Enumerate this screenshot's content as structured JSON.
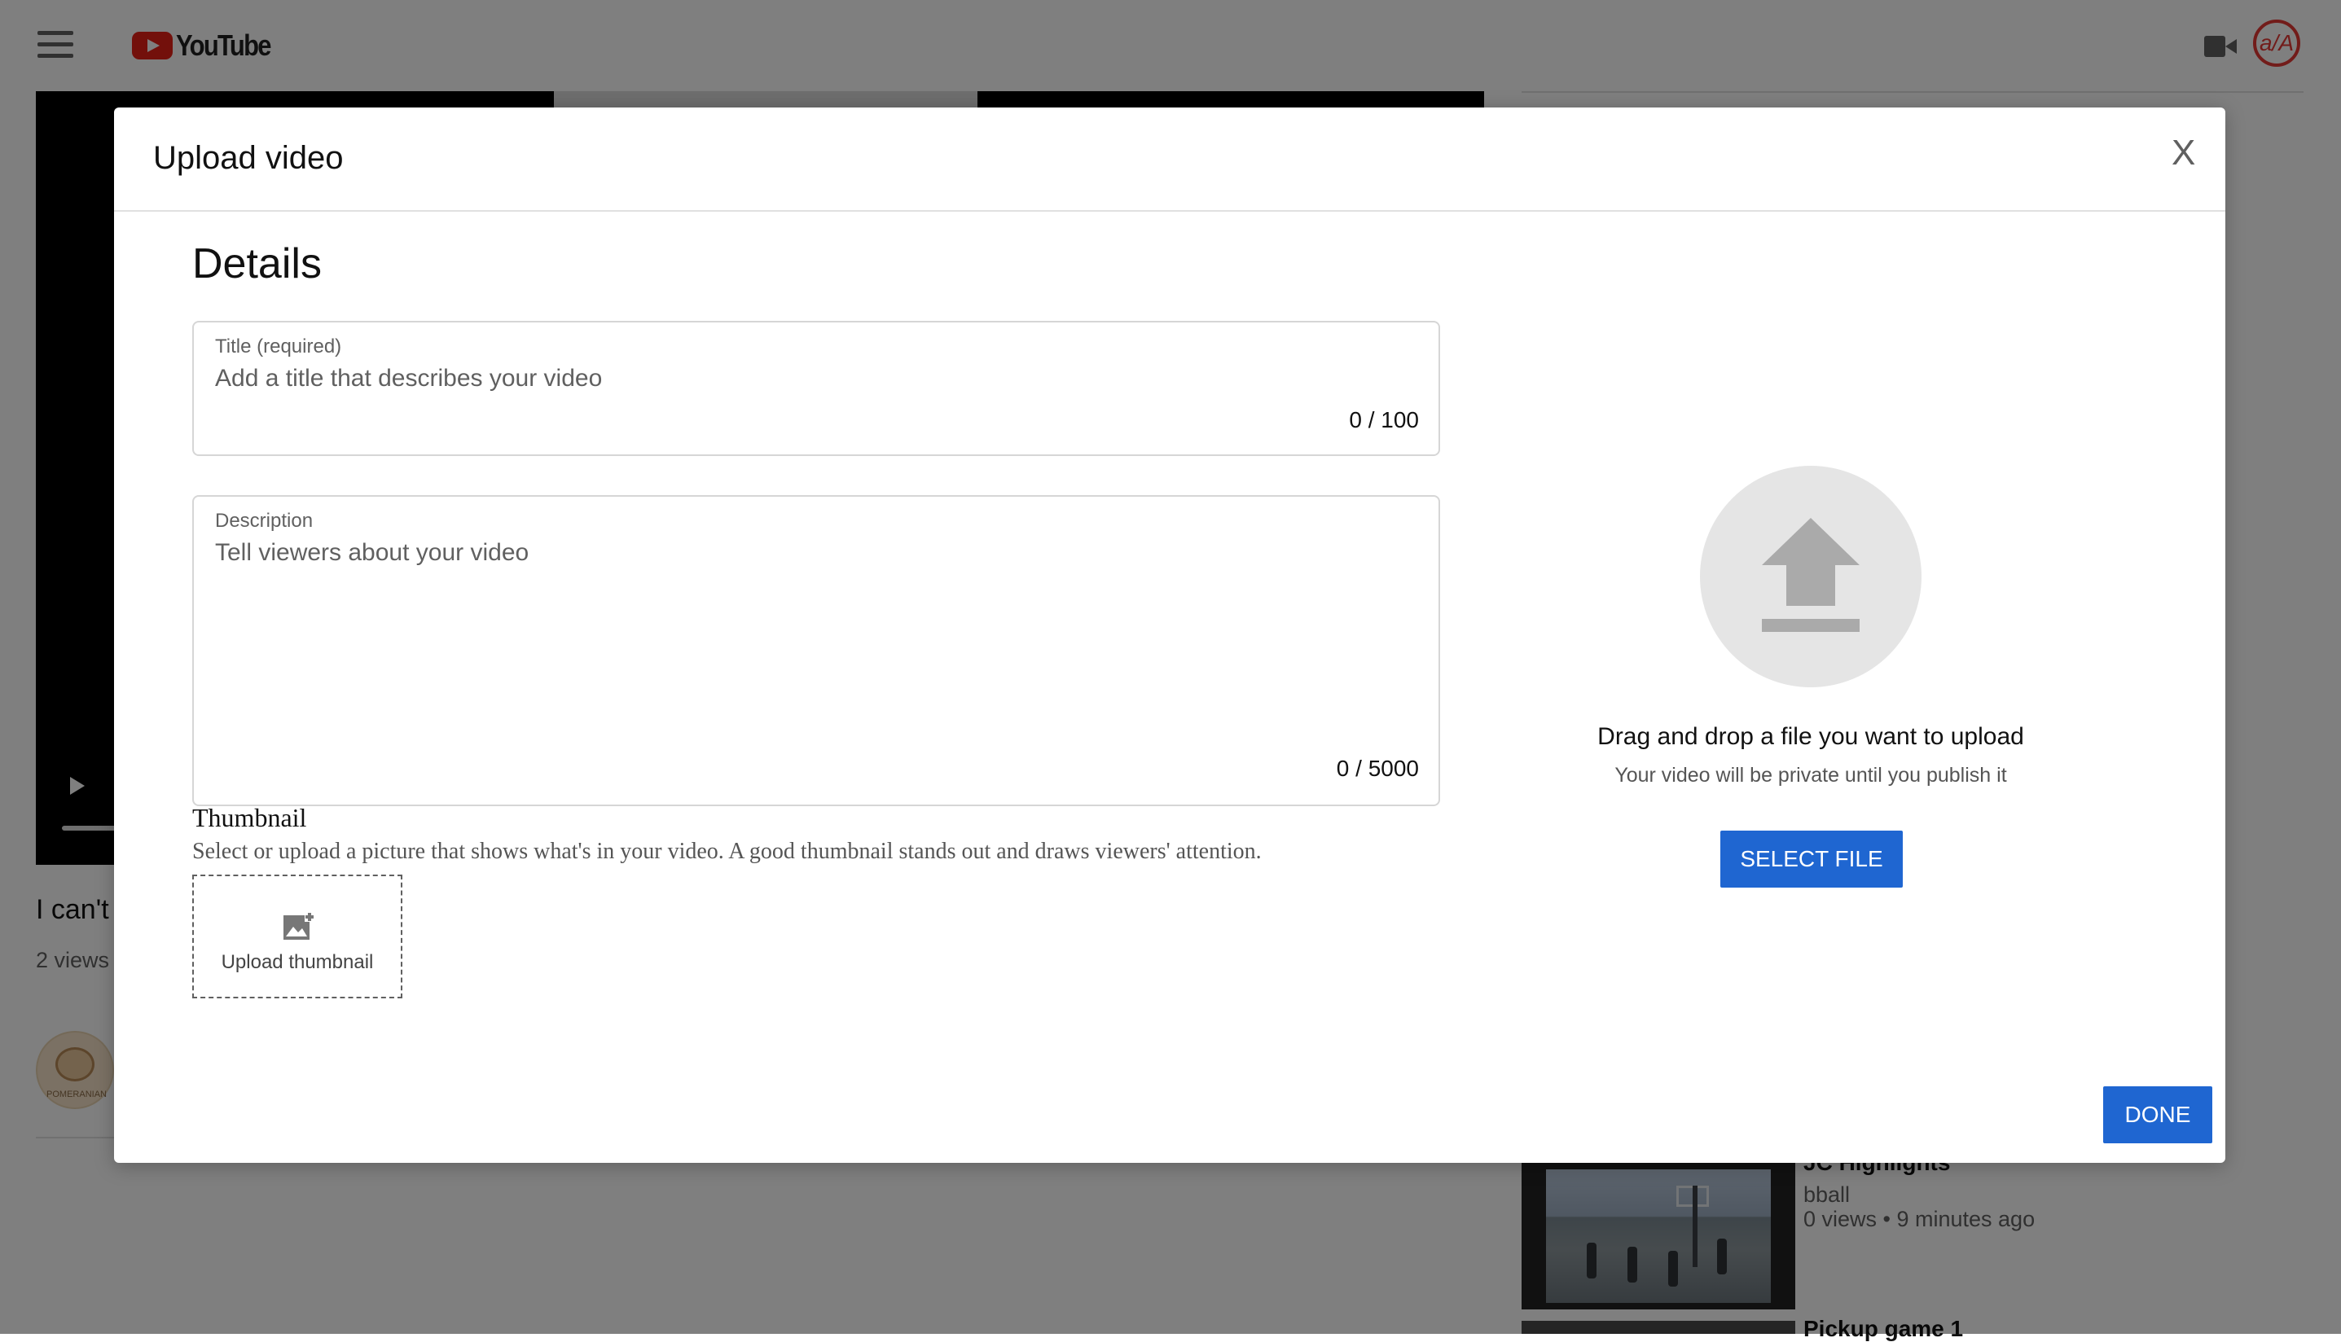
{
  "app": {
    "logo_text": "YouTube",
    "avatar_initials": "a/A"
  },
  "background": {
    "video_title": "I can't",
    "video_views": "2 views",
    "channel_avatar_label": "POMERANIAN",
    "sidebar_videos": [
      {
        "title": "JC Highlights",
        "channel": "bball",
        "meta": "0 views • 9 minutes ago"
      },
      {
        "title": "Pickup game 1"
      }
    ]
  },
  "dialog": {
    "title": "Upload video",
    "close_label": "X",
    "details_heading": "Details",
    "title_field": {
      "label": "Title (required)",
      "placeholder": "Add a title that describes your video",
      "value": "",
      "counter": "0 / 100"
    },
    "description_field": {
      "label": "Description",
      "placeholder": "Tell viewers about your video",
      "value": "",
      "counter": "0 / 5000"
    },
    "thumbnail": {
      "heading": "Thumbnail",
      "description": "Select or upload a picture that shows what's in your video. A good thumbnail stands out and draws viewers' attention.",
      "upload_label": "Upload thumbnail"
    },
    "upload": {
      "drag_text": "Drag and drop a file you want to upload",
      "private_text": "Your video will be private until you publish it",
      "select_button": "SELECT FILE"
    },
    "done_button": "DONE"
  },
  "colors": {
    "primary_button": "#1f66d1",
    "brand_red": "#e62117",
    "overlay": "rgba(0,0,0,0.5)"
  }
}
